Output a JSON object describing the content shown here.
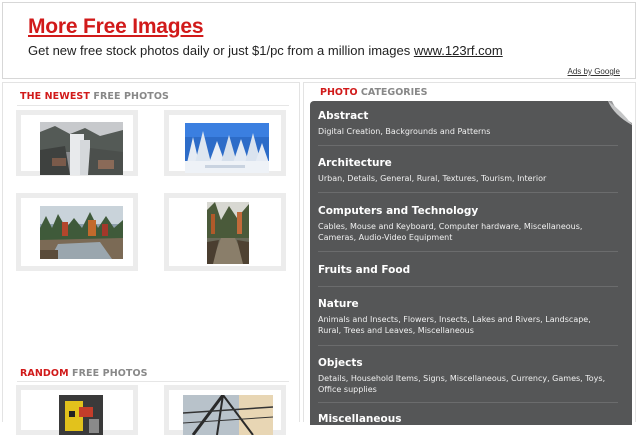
{
  "ad": {
    "title": "More Free Images",
    "text_prefix": "Get new free stock photos daily or just $1/pc from a million images ",
    "link": "www.123rf.com",
    "ads_by": "Ads by Google"
  },
  "newest": {
    "head_red": "THE NEWEST",
    "head_gray": " FREE PHOTOS"
  },
  "random": {
    "head_red": "RANDOM",
    "head_gray": " FREE PHOTOS"
  },
  "categories_head": {
    "red": "PHOTO",
    "gray": " CATEGORIES"
  },
  "categories": [
    {
      "title": "Abstract",
      "sub": "Digital Creation, Backgrounds and Patterns"
    },
    {
      "title": "Architecture",
      "sub": "Urban, Details, General, Rural, Textures, Tourism, Interior"
    },
    {
      "title": "Computers and Technology",
      "sub": "Cables, Mouse and Keyboard, Computer hardware, Miscellaneous, Cameras, Audio-Video Equipment"
    },
    {
      "title": "Fruits and Food",
      "sub": ""
    },
    {
      "title": "Nature",
      "sub": "Animals and Insects, Flowers, Insects, Lakes and Rivers, Landscape, Rural, Trees and Leaves, Miscellaneous"
    },
    {
      "title": "Objects",
      "sub": "Details, Household Items, Signs, Miscellaneous, Currency, Games, Toys, Office supplies"
    },
    {
      "title": "Miscellaneous",
      "sub": ""
    }
  ]
}
